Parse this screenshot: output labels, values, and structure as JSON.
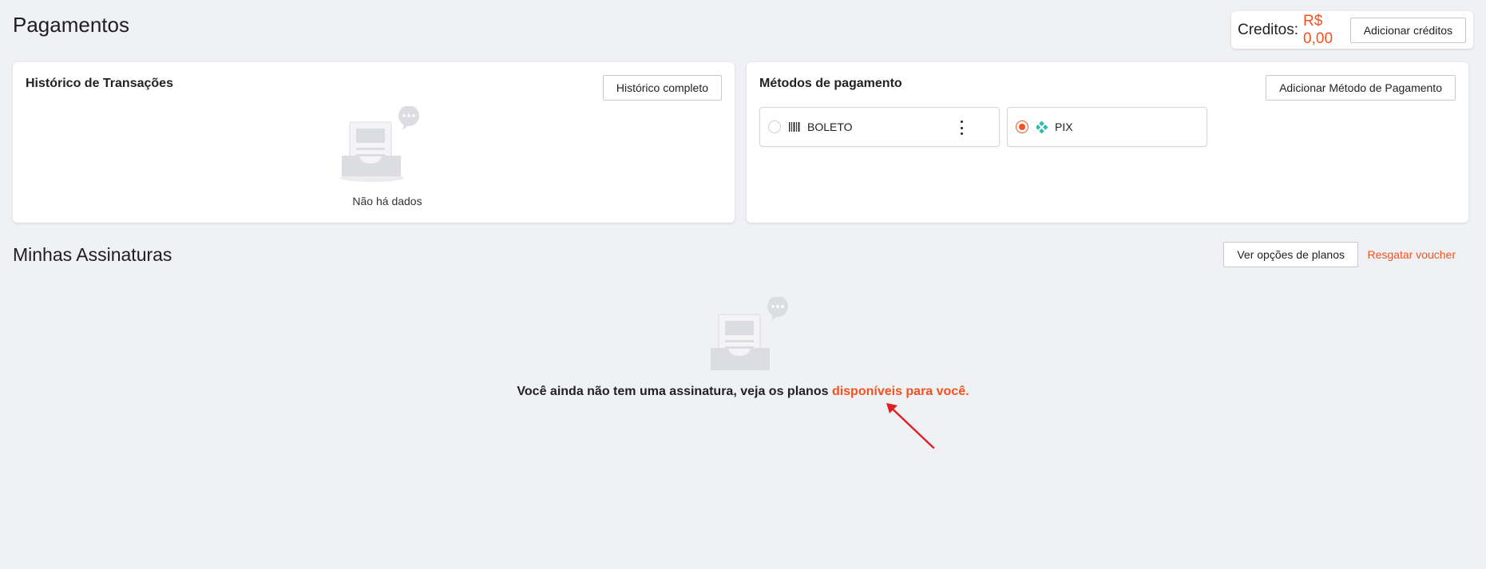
{
  "page": {
    "title": "Pagamentos"
  },
  "credits": {
    "label": "Creditos:",
    "value": "R$ 0,00",
    "add_button": "Adicionar créditos"
  },
  "transactions": {
    "title": "Histórico de Transações",
    "history_button": "Histórico completo",
    "empty_text": "Não há dados"
  },
  "payment_methods": {
    "title": "Métodos de pagamento",
    "add_button": "Adicionar Método de Pagamento",
    "methods": [
      {
        "label": "BOLETO",
        "icon": "barcode-icon",
        "selected": false
      },
      {
        "label": "PIX",
        "icon": "pix-icon",
        "selected": true,
        "icon_color": "#32bcad"
      }
    ]
  },
  "subscriptions": {
    "title": "Minhas Assinaturas",
    "plans_button": "Ver opções de planos",
    "voucher_link": "Resgatar voucher",
    "empty_text": "Você ainda não tem uma assinatura, veja os planos",
    "empty_link": "disponíveis para você."
  },
  "colors": {
    "accent": "#f4511e",
    "background": "#f0f1f5",
    "annotation_arrow": "#e02020"
  }
}
